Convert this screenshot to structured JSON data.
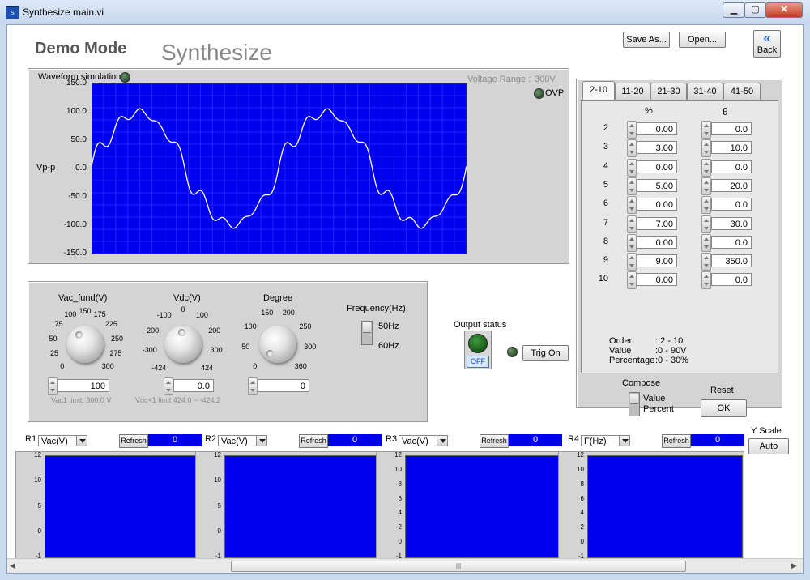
{
  "window": {
    "title": "Synthesize main.vi",
    "app_icon": "vi-icon"
  },
  "header": {
    "mode": "Demo Mode",
    "title": "Synthesize",
    "save_as": "Save As...",
    "open": "Open...",
    "back": "Back",
    "back_icon": "«"
  },
  "waveform": {
    "label": "Waveform simulation",
    "voltage_range_label": "Voltage Range :",
    "voltage_range_value": "300V",
    "ovp_label": "OVP",
    "ylabel": "Vp-p",
    "yticks": [
      "150.0",
      "100.0",
      "50.0",
      "0.0",
      "-50.0",
      "-100.0",
      "-150.0"
    ],
    "plot_color": "#0000ee"
  },
  "chart_data": {
    "type": "line",
    "title": "",
    "xlabel": "",
    "ylabel": "Vp-p",
    "ylim": [
      -150,
      150
    ],
    "xlim": [
      0,
      2
    ],
    "grid": true,
    "series": [
      {
        "name": "",
        "fundamental_amplitude": 100,
        "harmonics": [
          {
            "order": 3,
            "percent": 3.0,
            "phase": 10.0
          },
          {
            "order": 5,
            "percent": 5.0,
            "phase": 20.0
          },
          {
            "order": 7,
            "percent": 7.0,
            "phase": 30.0
          },
          {
            "order": 9,
            "percent": 9.0,
            "phase": 350.0
          }
        ],
        "color": "#ffffff"
      }
    ]
  },
  "controls": {
    "vac": {
      "label": "Vac_fund(V)",
      "value": "100",
      "limit_text": "Vac1 limit:",
      "limit_value": "300.0",
      "limit_unit": "V",
      "ticks": [
        "0",
        "25",
        "50",
        "75",
        "100",
        "150",
        "175",
        "225",
        "250",
        "275",
        "300"
      ]
    },
    "vdc": {
      "label": "Vdc(V)",
      "value": "0.0",
      "limit_text": "Vdc+1 limit",
      "limit_value": "424.0",
      "limit_sep": "~",
      "limit_value2": "-424.2",
      "ticks": [
        "-424",
        "-300",
        "-200",
        "-100",
        "0",
        "100",
        "200",
        "300",
        "424"
      ]
    },
    "degree": {
      "label": "Degree",
      "value": "0",
      "ticks": [
        "0",
        "50",
        "100",
        "150",
        "200",
        "250",
        "300",
        "360"
      ]
    },
    "frequency": {
      "label": "Frequency(Hz)",
      "opt1": "50Hz",
      "opt2": "60Hz"
    }
  },
  "output": {
    "label": "Output status",
    "state": "OFF",
    "trig": "Trig On"
  },
  "harmonics": {
    "tabs": [
      "2-10",
      "11-20",
      "21-30",
      "31-40",
      "41-50"
    ],
    "percent_header": "%",
    "theta_header": "θ",
    "rows": [
      {
        "n": "2",
        "pct": "0.00",
        "theta": "0.0"
      },
      {
        "n": "3",
        "pct": "3.00",
        "theta": "10.0"
      },
      {
        "n": "4",
        "pct": "0.00",
        "theta": "0.0"
      },
      {
        "n": "5",
        "pct": "5.00",
        "theta": "20.0"
      },
      {
        "n": "6",
        "pct": "0.00",
        "theta": "0.0"
      },
      {
        "n": "7",
        "pct": "7.00",
        "theta": "30.0"
      },
      {
        "n": "8",
        "pct": "0.00",
        "theta": "0.0"
      },
      {
        "n": "9",
        "pct": "9.00",
        "theta": "350.0"
      },
      {
        "n": "10",
        "pct": "0.00",
        "theta": "0.0"
      }
    ],
    "info": [
      {
        "k": "Order",
        "v": ": 2 - 10"
      },
      {
        "k": "Value",
        "v": ":0  - 90V"
      },
      {
        "k": "Percentage",
        "v": ":0 - 30%"
      }
    ],
    "compose_label": "Compose",
    "compose_opt1": "Value",
    "compose_opt2": "Percent",
    "reset_label": "Reset",
    "ok": "OK"
  },
  "graphs": {
    "refresh": "Refresh",
    "yscale_label": "Y Scale",
    "yscale_value": "Auto",
    "items": [
      {
        "id": "R1",
        "select": "Vac(V)",
        "value": "0",
        "ticks": [
          "12",
          "10",
          "5",
          "0",
          "-1"
        ]
      },
      {
        "id": "R2",
        "select": "Vac(V)",
        "value": "0",
        "ticks": [
          "12",
          "10",
          "5",
          "0",
          "-1"
        ]
      },
      {
        "id": "R3",
        "select": "Vac(V)",
        "value": "0",
        "ticks": [
          "12",
          "10",
          "8",
          "6",
          "4",
          "2",
          "0",
          "-1"
        ]
      },
      {
        "id": "R4",
        "select": "F(Hz)",
        "value": "0",
        "ticks": [
          "12",
          "10",
          "8",
          "6",
          "4",
          "2",
          "0",
          "-1"
        ]
      }
    ]
  },
  "scrollbar": {
    "grip": "|||"
  }
}
